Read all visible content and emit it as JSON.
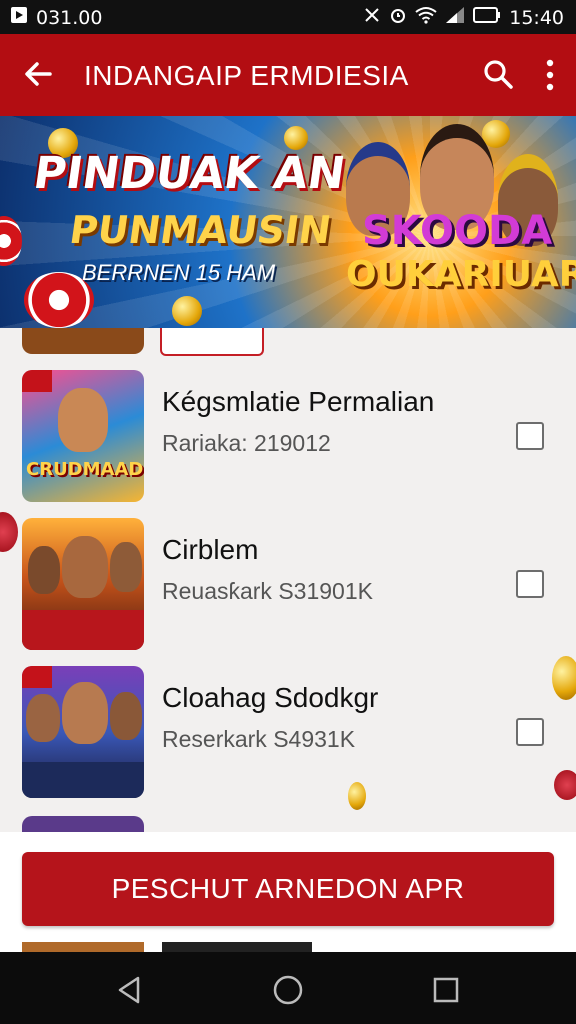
{
  "status": {
    "left_text": "031.00",
    "time": "15:40"
  },
  "appbar": {
    "title": "INDANGAIP ERMDIESIA",
    "icons": [
      "back-arrow-icon",
      "search-icon",
      "more-vert-icon"
    ]
  },
  "banner": {
    "headline": "PINDUAK AN",
    "subheadline": "PUNMAUSIN",
    "tagline": "BERRNEN 15 HAM",
    "brand_top": "SKOODA",
    "brand_bottom": "OUKARIUAR"
  },
  "list": {
    "items": [
      {
        "title": "Kégsmlatie Permalian",
        "subtitle": "Rariaka: 219012",
        "thumb_label": "CRUDMAAD",
        "checked": false
      },
      {
        "title": "Cirblem",
        "subtitle": "Reuasƙark S31901K",
        "thumb_label": "",
        "checked": false
      },
      {
        "title": "Cloahag Sdodkgr",
        "subtitle": "Reserkark S4931K",
        "thumb_label": "",
        "checked": false
      }
    ]
  },
  "cta": {
    "label": "PESCHUT ARNEDON APR"
  },
  "colors": {
    "primary": "#b30d12",
    "button": "#b5141b",
    "background": "#f2f0ef"
  }
}
